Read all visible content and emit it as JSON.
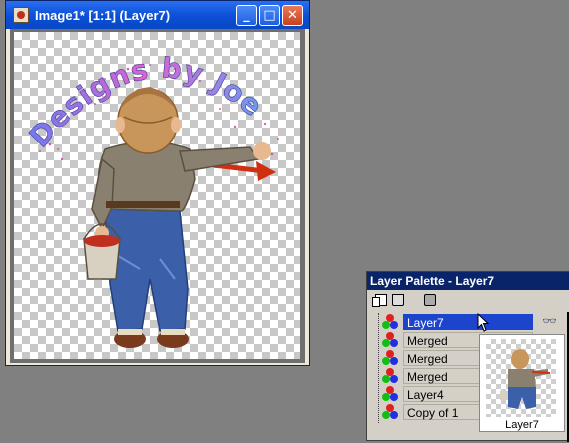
{
  "image_window": {
    "title": "Image1* [1:1] (Layer7)",
    "buttons": {
      "minimize": "_",
      "maximize": "□",
      "close": "✕"
    },
    "artwork_text": "Designs by Joe"
  },
  "layer_palette": {
    "title": "Layer Palette - Layer7",
    "toolbar_icons": [
      "new-layer-icon",
      "delete-layer-icon",
      "mask-icon"
    ],
    "layers": [
      {
        "name": "Layer7",
        "active": true,
        "visibility_icon": "glasses-icon"
      },
      {
        "name": "Merged",
        "active": false
      },
      {
        "name": "Merged",
        "active": false
      },
      {
        "name": "Merged",
        "active": false
      },
      {
        "name": "Layer4",
        "active": false
      },
      {
        "name": "Copy of 1",
        "active": false
      }
    ],
    "thumbnail_label": "Layer7"
  },
  "colors": {
    "desktop": "#808080",
    "titlebar": "#0a4fd6",
    "selected_layer": "#1c44cc",
    "arrow": "#d03010"
  }
}
